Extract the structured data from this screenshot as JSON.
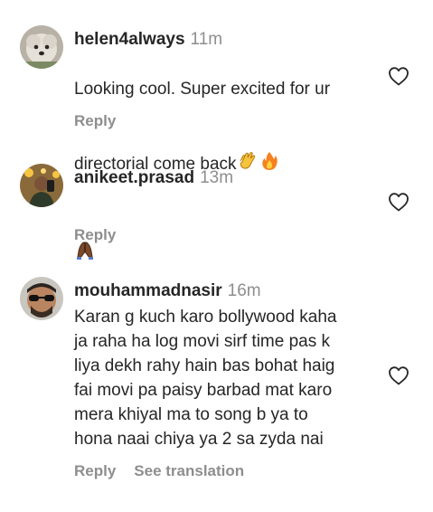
{
  "comments": [
    {
      "username": "helen4always",
      "time": "11m",
      "text_line1": "Looking cool. Super excited for ur",
      "text_line2": "directorial come back",
      "emojis": [
        "clapping-hands",
        "fire"
      ],
      "reply_label": "Reply"
    },
    {
      "username": "anikeet.prasad",
      "time": "13m",
      "emojis": [
        "folded-hands"
      ],
      "reply_label": "Reply"
    },
    {
      "username": "mouhammadnasir",
      "time": "16m",
      "text": "Karan g kuch karo bollywood kaha\nja raha ha log movi sirf time pas k\nliya dekh rahy hain bas bohat haig\nfai movi pa paisy barbad mat karo\nmera khiyal ma to song b ya to\nhona naai chiya ya 2 sa zyda nai",
      "reply_label": "Reply",
      "translate_label": "See translation"
    }
  ],
  "colors": {
    "text": "#262626",
    "secondary": "#8e8e8e",
    "background": "#ffffff"
  }
}
